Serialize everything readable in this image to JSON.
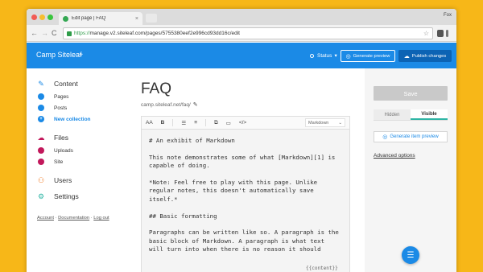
{
  "browser": {
    "tab_title": "Edit page | FAQ",
    "tab_close": "×",
    "profile": "Fox",
    "url_scheme": "https://",
    "url_rest": "manage.v2.siteleaf.com/pages/5755380eef2e996cd93dd16c/edit",
    "back": "←",
    "forward": "→",
    "reload": "C",
    "star": "☆"
  },
  "header": {
    "site_name": "Camp Siteleaf",
    "caret": "⌄",
    "status_label": "Status",
    "status_caret": "▾",
    "preview_label": "Generate preview",
    "publish_label": "Publish changes"
  },
  "sidebar": {
    "content": "Content",
    "pages": "Pages",
    "posts": "Posts",
    "new_collection": "New collection",
    "files": "Files",
    "uploads": "Uploads",
    "site": "Site",
    "users": "Users",
    "settings": "Settings",
    "footer": {
      "account": "Account",
      "sep1": " · ",
      "documentation": "Documentation",
      "sep2": " · ",
      "logout": "Log out"
    }
  },
  "main": {
    "title": "FAQ",
    "url": "camp.siteleaf.net/faq/",
    "toolbar": {
      "font_size": "AA",
      "bold": "B",
      "list": "☰",
      "olist": "≡",
      "link": "⧉",
      "image": "▭",
      "code": "</>",
      "format": "Markdown",
      "format_caret": "⌄"
    },
    "editor_lines": [
      "# An exhibit of Markdown",
      "This note demonstrates some of what [Markdown][1] is\ncapable of doing.",
      "*Note: Feel free to play with this page. Unlike\nregular notes, this doesn't automatically save\nitself.*",
      "## Basic formatting",
      "Paragraphs can be written like so. A paragraph is the\nbasic block of Markdown. A paragraph is what text\nwill turn into when there is no reason it should"
    ],
    "content_tag": "{{content}}"
  },
  "panel": {
    "save": "Save",
    "hidden": "Hidden",
    "visible": "Visible",
    "generate_item_preview": "Generate item preview",
    "advanced_options": "Advanced options"
  },
  "colors": {
    "accent": "#1b8ae6",
    "files": "#c2185b",
    "users": "#f07c27",
    "settings": "#2fb5a5",
    "background": "#f7b718"
  }
}
